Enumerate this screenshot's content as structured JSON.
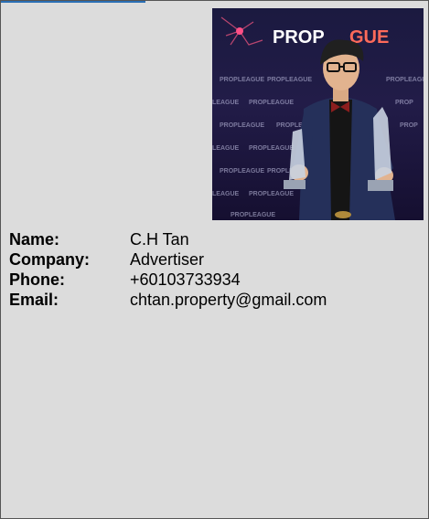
{
  "profile": {
    "photo_icon": "person-holding-trophies-photo",
    "photo_banner_text": "PROP LEAGUE",
    "fields": [
      {
        "label": "Name:",
        "value": "C.H Tan"
      },
      {
        "label": "Company:",
        "value": "Advertiser"
      },
      {
        "label": "Phone:",
        "value": "+60103733934"
      },
      {
        "label": "Email:",
        "value": "chtan.property@gmail.com"
      }
    ]
  },
  "colors": {
    "card_background": "#dcdcdc",
    "accent": "#2a6fb4"
  }
}
